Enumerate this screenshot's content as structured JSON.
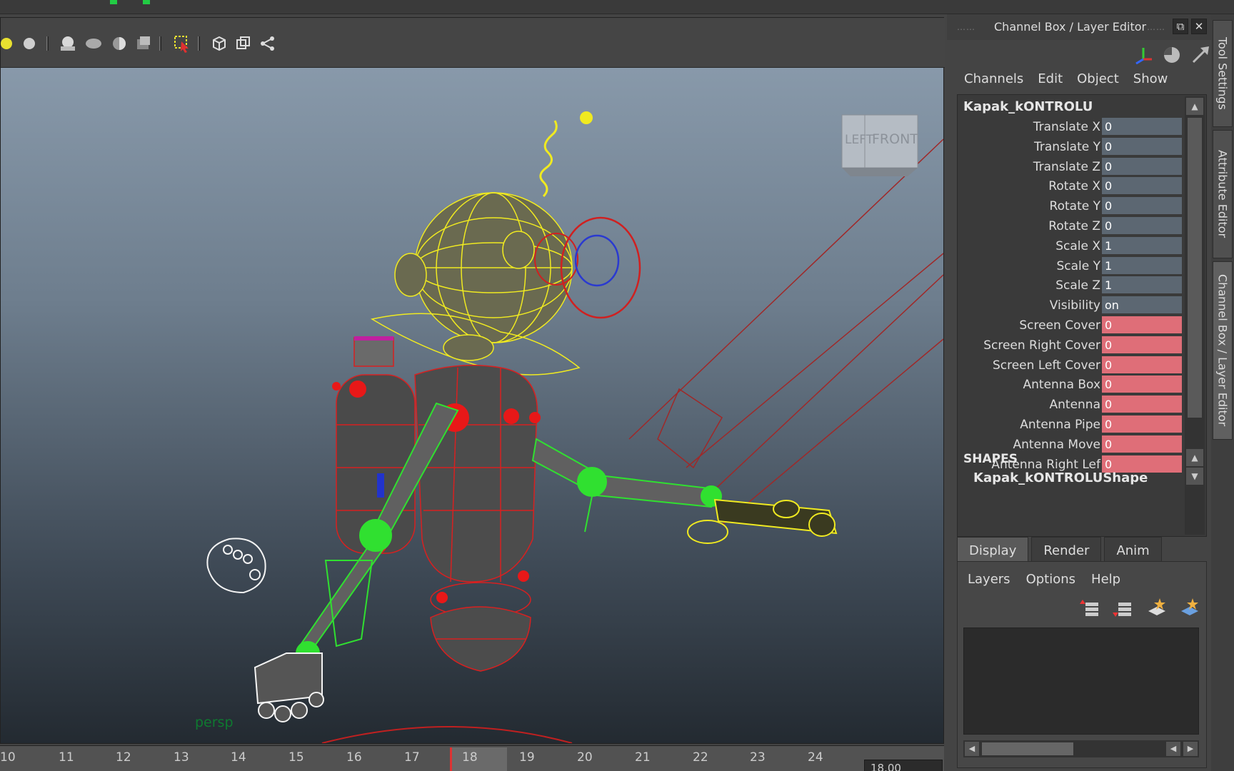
{
  "window": {
    "title": ""
  },
  "viewport": {
    "camera_label": "persp",
    "view_cube": {
      "left": "LEFT",
      "front": "FRONT"
    },
    "toolbar_icons": [
      "light-yellow-icon",
      "light-gray-icon",
      "shade-smooth-icon",
      "shade-flat-icon",
      "shade-half-icon",
      "shade-box-icon",
      "select-icon",
      "cube-icon",
      "duplicate-icon",
      "share-icon"
    ]
  },
  "timeline": {
    "ticks": [
      "10",
      "11",
      "12",
      "13",
      "14",
      "15",
      "16",
      "17",
      "18",
      "19",
      "20",
      "21",
      "22",
      "23",
      "24"
    ],
    "current_frame": "18",
    "frame_field": "18.00",
    "playback": [
      "⏮",
      "⏪",
      "|◀",
      "◀",
      "▶",
      "▶|",
      "⏩",
      "⏭"
    ]
  },
  "channel_box": {
    "title": "Channel Box / Layer Editor",
    "menu": [
      "Channels",
      "Edit",
      "Object",
      "Show"
    ],
    "node_name": "Kapak_kONTROLU",
    "attributes": [
      {
        "label": "Translate X",
        "value": "0",
        "keyed": false
      },
      {
        "label": "Translate Y",
        "value": "0",
        "keyed": false
      },
      {
        "label": "Translate Z",
        "value": "0",
        "keyed": false
      },
      {
        "label": "Rotate X",
        "value": "0",
        "keyed": false
      },
      {
        "label": "Rotate Y",
        "value": "0",
        "keyed": false
      },
      {
        "label": "Rotate Z",
        "value": "0",
        "keyed": false
      },
      {
        "label": "Scale X",
        "value": "1",
        "keyed": false
      },
      {
        "label": "Scale Y",
        "value": "1",
        "keyed": false
      },
      {
        "label": "Scale Z",
        "value": "1",
        "keyed": false
      },
      {
        "label": "Visibility",
        "value": "on",
        "keyed": false
      },
      {
        "label": "Screen Cover",
        "value": "0",
        "keyed": true
      },
      {
        "label": "Screen Right Cover",
        "value": "0",
        "keyed": true
      },
      {
        "label": "Screen Left Cover",
        "value": "0",
        "keyed": true
      },
      {
        "label": "Antenna Box",
        "value": "0",
        "keyed": true
      },
      {
        "label": "Antenna",
        "value": "0",
        "keyed": true
      },
      {
        "label": "Antenna Pipe",
        "value": "0",
        "keyed": true
      },
      {
        "label": "Antenna Move",
        "value": "0",
        "keyed": true
      },
      {
        "label": "Antenna Right Lef",
        "value": "0",
        "keyed": true
      }
    ],
    "shapes_header": "SHAPES",
    "shape_node": "Kapak_kONTROLUShape",
    "keyed_color": "#df6e78",
    "value_color": "#5c6772"
  },
  "layer_editor": {
    "tabs": [
      "Display",
      "Render",
      "Anim"
    ],
    "active_tab": "Display",
    "menu": [
      "Layers",
      "Options",
      "Help"
    ],
    "icons": [
      "layer-move-up-icon",
      "layer-move-down-icon",
      "new-layer-icon",
      "new-layer-selected-icon"
    ]
  },
  "side_tabs": [
    "Tool Settings",
    "Attribute Editor",
    "Channel Box / Layer Editor"
  ]
}
